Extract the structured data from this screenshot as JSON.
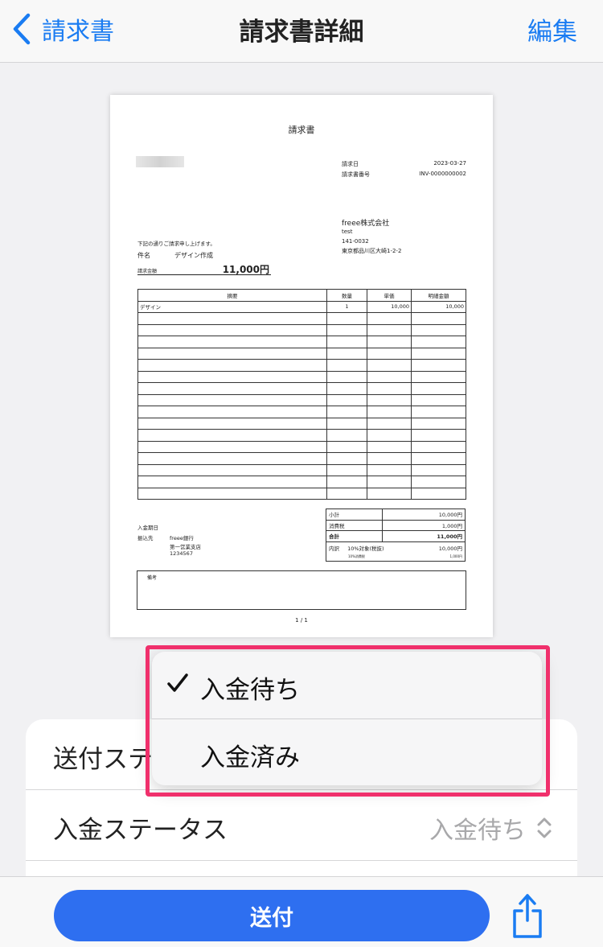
{
  "nav": {
    "back_label": "請求書",
    "title": "請求書詳細",
    "edit_label": "編集"
  },
  "document": {
    "title": "請求書",
    "invoice_date_label": "請求日",
    "invoice_date": "2023-03-27",
    "invoice_number_label": "請求書番号",
    "invoice_number": "INV-0000000002",
    "company_name": "freee株式会社",
    "company_contact": "test",
    "company_postal": "141-0032",
    "company_address": "東京都品川区大崎1-2-2",
    "intro_text": "下記の通りご請求申し上げます。",
    "subject_label": "件名",
    "subject": "デザイン作成",
    "amount_label": "請求金額",
    "amount": "11,000円",
    "columns": [
      "摘要",
      "数量",
      "単価",
      "明細金額"
    ],
    "items": [
      {
        "desc": "デザイン",
        "qty": "1",
        "unit_price": "10,000",
        "amount": "10,000"
      }
    ],
    "due_date_label": "入金期日",
    "bank_label": "振込先",
    "bank_name": "freee銀行",
    "bank_branch": "第一営業支店",
    "bank_account": "1234567",
    "subtotal_label": "小計",
    "subtotal": "10,000円",
    "tax_label": "消費税",
    "tax": "1,000円",
    "total_label": "合計",
    "total": "11,000円",
    "breakdown_label": "内訳",
    "breakdown_rate": "10%対象(税抜)",
    "breakdown_amount": "10,000円",
    "breakdown_tax_label": "10%消費税",
    "breakdown_tax": "1,000円",
    "remarks_label": "備考",
    "page_number": "1 / 1"
  },
  "sheet": {
    "send_status_label": "送付ステータス",
    "payment_status_label": "入金ステータス",
    "payment_status_value": "入金待ち"
  },
  "dropdown": {
    "options": [
      {
        "label": "入金待ち",
        "selected": true
      },
      {
        "label": "入金済み",
        "selected": false
      }
    ]
  },
  "toolbar": {
    "send_label": "送付"
  },
  "colors": {
    "accent": "#1a7cf2",
    "button": "#2e6ff0",
    "highlight": "#f0306c"
  }
}
